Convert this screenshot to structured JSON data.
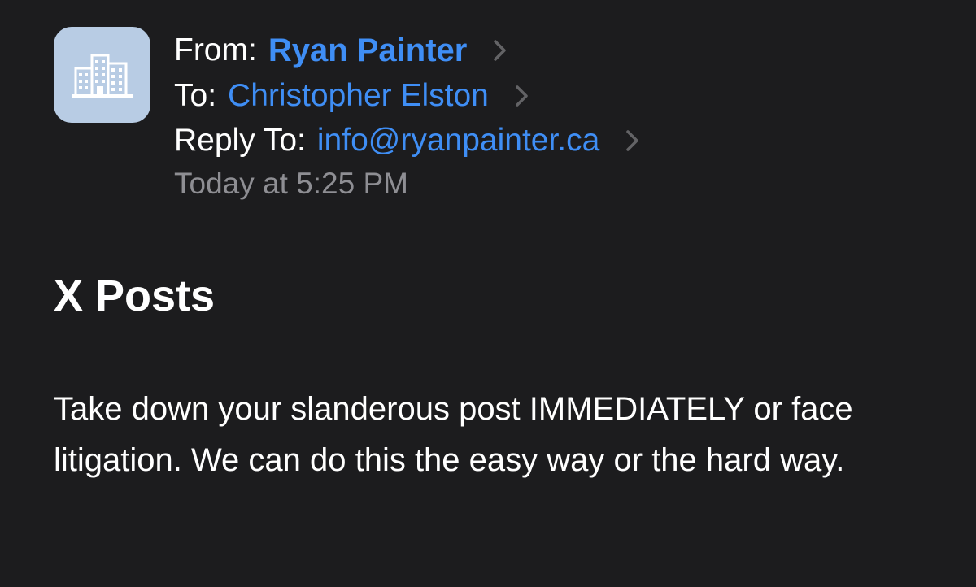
{
  "header": {
    "avatar_icon": "building-icon",
    "from_label": "From:",
    "from_name": "Ryan Painter",
    "to_label": "To:",
    "to_name": "Christopher Elston",
    "reply_label": "Reply To:",
    "reply_address": "info@ryanpainter.ca",
    "date": "Today at 5:25 PM",
    "chevron_icon": "chevron-right-icon"
  },
  "message": {
    "subject": "X Posts",
    "body": "Take down your slanderous post IMMEDIATELY or face litigation. We can do this the easy way or the hard way."
  },
  "colors": {
    "background": "#1c1c1e",
    "link": "#3f8ef5",
    "secondary_text": "#8e8e93",
    "avatar_bg": "#b8cce4"
  }
}
